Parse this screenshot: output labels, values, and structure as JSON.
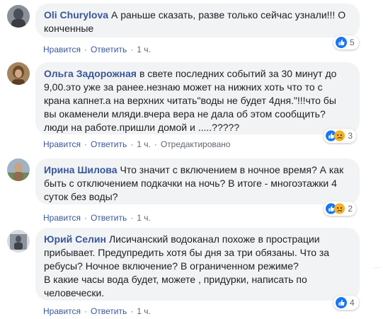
{
  "comments": [
    {
      "author": "Oli Churylova",
      "text": "А раньше сказать, разве только сейчас узнали!!! О\nконченные",
      "reaction_count": "5",
      "like_label": "Нравится",
      "reply_label": "Ответить",
      "time": "1 ч.",
      "edited": ""
    },
    {
      "author": "Ольга Задорожная",
      "text": "в свете последних событий за 30 минут до\n9,00.это уже за ранее.незнаю может на нижних хоть что то с\nкрана капнет.а на верхних читать\"воды не будет 4дня.\"!!!что бы\nвы окаменели мляди.вчера вера не дала об этом сообщить?\nлюди на работе.пришли домой и .....?????",
      "reaction_count": "3",
      "like_label": "Нравится",
      "reply_label": "Ответить",
      "time": "1 ч.",
      "edited": "Отредактировано"
    },
    {
      "author": "Ирина Шилова",
      "text": "Что значит с включением в ночное время? А как\nбыть с отключением подкачки на ночь? В итоге - многоэтажки 4\nсуток без воды?",
      "reaction_count": "2",
      "like_label": "Нравится",
      "reply_label": "Ответить",
      "time": "1 ч.",
      "edited": ""
    },
    {
      "author": "Юрий Селин",
      "text": "Лисичанский водоканал похоже в прострации\nприбывает. Предупредить хотя бы дня за три обязаны. Что за\nребусы? Ночное включение? В ограниченном режиме?\nВ какие часы вода будет, можете , придурки, написать по\nчеловечески.",
      "reaction_count": "4",
      "like_label": "Нравится",
      "reply_label": "Ответить",
      "time": "1 ч.",
      "edited": ""
    }
  ],
  "colors": {
    "bubble_bg": "#f2f3f5",
    "author": "#385898",
    "like_blue": "#1877f2",
    "sad_yellow": "#f7b125",
    "meta_gray": "#606770"
  },
  "icons": {
    "like": "thumbs-up-icon",
    "sad": "sad-face-icon"
  }
}
